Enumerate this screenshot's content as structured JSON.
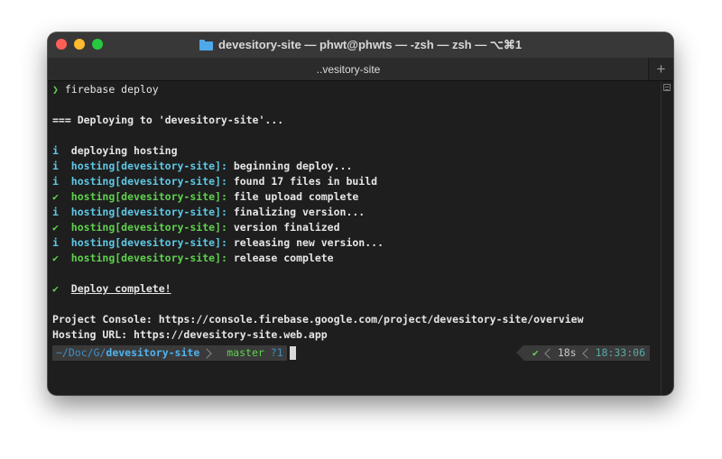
{
  "window": {
    "title": "devesitory-site — phwt@phwts — -zsh — zsh — ⌥⌘1",
    "folder_icon": "folder-icon"
  },
  "tabs": [
    {
      "label": "..vesitory-site",
      "active": true
    }
  ],
  "new_tab_label": "+",
  "terminal": {
    "prompt_symbol": "❯",
    "command": "firebase deploy",
    "deploying_header": "=== Deploying to 'devesitory-site'...",
    "deploying_hosting": {
      "marker": "i",
      "text_pre": "deploying ",
      "text_bold": "hosting"
    },
    "log": [
      {
        "marker": "i",
        "kind": "info",
        "tag": "hosting[devesitory-site]:",
        "msg": "beginning deploy..."
      },
      {
        "marker": "i",
        "kind": "info",
        "tag": "hosting[devesitory-site]:",
        "msg_pre": "found 17 files in ",
        "msg_bold": "build"
      },
      {
        "marker": "✔",
        "kind": "success",
        "tag": "hosting[devesitory-site]:",
        "msg": "file upload complete"
      },
      {
        "marker": "i",
        "kind": "info",
        "tag": "hosting[devesitory-site]:",
        "msg": "finalizing version..."
      },
      {
        "marker": "✔",
        "kind": "success",
        "tag": "hosting[devesitory-site]:",
        "msg": "version finalized"
      },
      {
        "marker": "i",
        "kind": "info",
        "tag": "hosting[devesitory-site]:",
        "msg": "releasing new version..."
      },
      {
        "marker": "✔",
        "kind": "success",
        "tag": "hosting[devesitory-site]:",
        "msg": "release complete"
      }
    ],
    "deploy_complete": {
      "marker": "✔",
      "text": "Deploy complete!"
    },
    "project_console": {
      "label": "Project Console:",
      "url": "https://console.firebase.google.com/project/devesitory-site/overview"
    },
    "hosting_url": {
      "label": "Hosting URL:",
      "url": "https://devesitory-site.web.app"
    }
  },
  "statusline": {
    "path_prefix": "~/Doc/G/",
    "path_dir": "devesitory-site",
    "git_branch": "master",
    "git_status": "?1",
    "exit_status": "✔",
    "duration": "18s",
    "time": "18:33:06"
  },
  "colors": {
    "info": "#5ec8e5",
    "success": "#5fd14e",
    "path": "#4fb3f0",
    "background": "#1e1e1e"
  }
}
